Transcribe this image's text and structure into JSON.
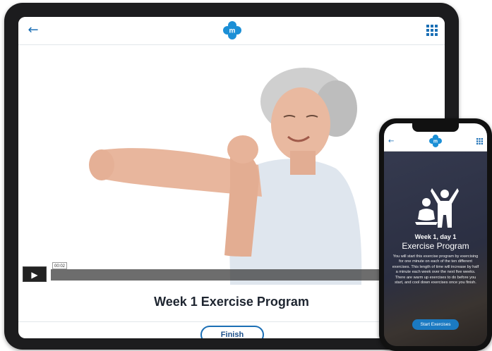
{
  "tablet": {
    "header": {
      "back_icon": "arrow-left-icon",
      "logo_letter": "m",
      "menu_icon": "grid-icon"
    },
    "video": {
      "play_icon": "play-icon",
      "timestamp": "00:02"
    },
    "title": "Week 1 Exercise Program",
    "finish_label": "Finish"
  },
  "phone": {
    "header": {
      "back_icon": "arrow-left-icon",
      "logo_letter": "m",
      "menu_icon": "grid-icon"
    },
    "week_label": "Week 1, day 1",
    "program_title": "Exercise Program",
    "description": "You will start this exercise program by exercising for one minute on each of the ten different exercises. This length of time will increase by half a minute each week over the next five weeks. There are warm up exercises to do before you start, and cool down exercises once you finish.",
    "start_label": "Start Exercises"
  },
  "colors": {
    "brand_blue": "#1b6fb5",
    "button_blue": "#1b7ac2",
    "title_dark": "#1e2530",
    "phone_bg": "#2e3244"
  }
}
